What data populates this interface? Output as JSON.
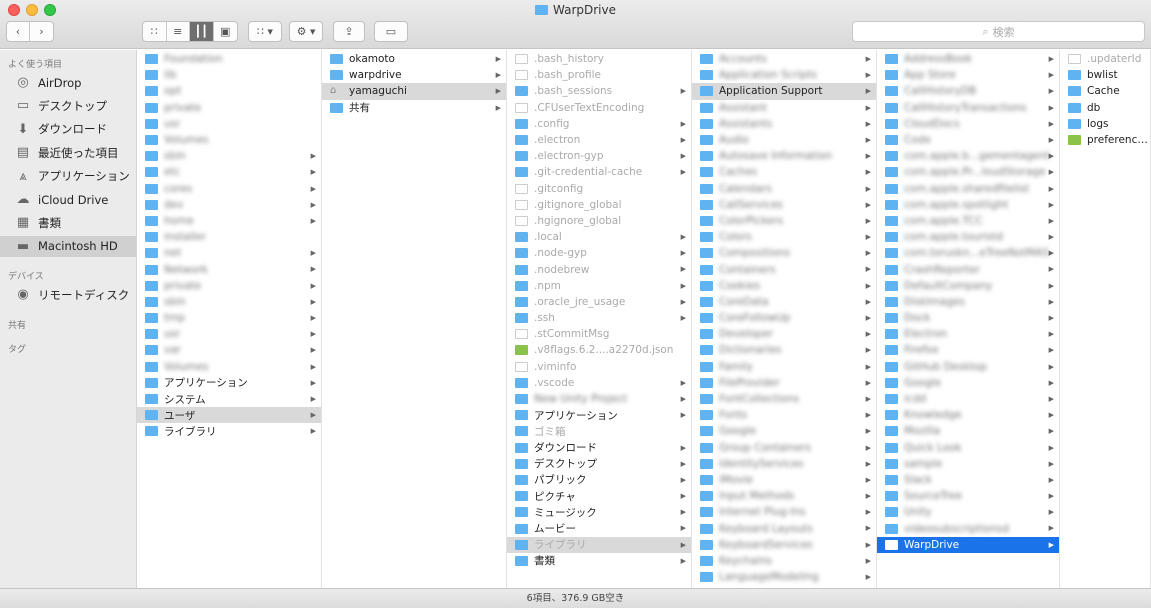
{
  "window": {
    "title": "WarpDrive"
  },
  "toolbar": {
    "search_placeholder": "検索"
  },
  "sidebar": {
    "sections": [
      {
        "label": "よく使う項目"
      },
      {
        "label": "デバイス"
      },
      {
        "label": "共有"
      },
      {
        "label": "タグ"
      }
    ],
    "favorites": [
      {
        "label": "AirDrop",
        "icon": "airdrop-icon"
      },
      {
        "label": "デスクトップ",
        "icon": "desktop-icon"
      },
      {
        "label": "ダウンロード",
        "icon": "download-icon"
      },
      {
        "label": "最近使った項目",
        "icon": "recent-icon"
      },
      {
        "label": "アプリケーション",
        "icon": "applications-icon"
      },
      {
        "label": "iCloud Drive",
        "icon": "cloud-icon"
      },
      {
        "label": "書類",
        "icon": "documents-icon"
      },
      {
        "label": "Macintosh HD",
        "icon": "disk-icon",
        "selected": true
      }
    ],
    "devices": [
      {
        "label": "リモートディスク",
        "icon": "remote-disc-icon"
      }
    ]
  },
  "columns": [
    {
      "name": "col-root",
      "rows": [
        {
          "label": "Foundation",
          "blur": true
        },
        {
          "label": "lib",
          "blur": true
        },
        {
          "label": "opt",
          "blur": true
        },
        {
          "label": "private",
          "blur": true
        },
        {
          "label": "usr",
          "blur": true
        },
        {
          "label": "Volumes",
          "blur": true
        },
        {
          "label": "sbin",
          "blur": true,
          "arrow": true
        },
        {
          "label": "etc",
          "blur": true,
          "arrow": true
        },
        {
          "label": "cores",
          "blur": true,
          "arrow": true
        },
        {
          "label": "dev",
          "blur": true,
          "arrow": true
        },
        {
          "label": "home",
          "blur": true,
          "arrow": true
        },
        {
          "label": "installer",
          "blur": true
        },
        {
          "label": "net",
          "blur": true,
          "arrow": true
        },
        {
          "label": "Network",
          "blur": true,
          "arrow": true
        },
        {
          "label": "private",
          "blur": true,
          "arrow": true
        },
        {
          "label": "sbin",
          "blur": true,
          "arrow": true
        },
        {
          "label": "tmp",
          "blur": true,
          "arrow": true
        },
        {
          "label": "usr",
          "blur": true,
          "arrow": true
        },
        {
          "label": "var",
          "blur": true,
          "arrow": true
        },
        {
          "label": "Volumes",
          "blur": true,
          "arrow": true
        },
        {
          "label": "アプリケーション",
          "arrow": true
        },
        {
          "label": "システム",
          "arrow": true
        },
        {
          "label": "ユーザ",
          "arrow": true,
          "state": "gray"
        },
        {
          "label": "ライブラリ",
          "arrow": true
        }
      ]
    },
    {
      "name": "col-users",
      "rows": [
        {
          "label": "okamoto",
          "arrow": true
        },
        {
          "label": "warpdrive",
          "arrow": true
        },
        {
          "label": "yamaguchi",
          "arrow": true,
          "state": "gray",
          "icon": "home"
        },
        {
          "label": "共有",
          "arrow": true
        }
      ]
    },
    {
      "name": "col-home",
      "rows": [
        {
          "label": ".bash_history",
          "doc": true,
          "dim": true
        },
        {
          "label": ".bash_profile",
          "doc": true,
          "dim": true
        },
        {
          "label": ".bash_sessions",
          "dim": true,
          "arrow": true
        },
        {
          "label": ".CFUserTextEncoding",
          "doc": true,
          "dim": true
        },
        {
          "label": ".config",
          "dim": true,
          "arrow": true
        },
        {
          "label": ".electron",
          "dim": true,
          "arrow": true
        },
        {
          "label": ".electron-gyp",
          "dim": true,
          "arrow": true
        },
        {
          "label": ".git-credential-cache",
          "dim": true,
          "arrow": true
        },
        {
          "label": ".gitconfig",
          "doc": true,
          "dim": true
        },
        {
          "label": ".gitignore_global",
          "doc": true,
          "dim": true
        },
        {
          "label": ".hgignore_global",
          "doc": true,
          "dim": true
        },
        {
          "label": ".local",
          "dim": true,
          "arrow": true
        },
        {
          "label": ".node-gyp",
          "dim": true,
          "arrow": true
        },
        {
          "label": ".nodebrew",
          "dim": true,
          "arrow": true
        },
        {
          "label": ".npm",
          "dim": true,
          "arrow": true
        },
        {
          "label": ".oracle_jre_usage",
          "dim": true,
          "arrow": true
        },
        {
          "label": ".ssh",
          "dim": true,
          "arrow": true
        },
        {
          "label": ".stCommitMsg",
          "doc": true,
          "dim": true
        },
        {
          "label": ".v8flags.6.2....a2270d.json",
          "dim": true,
          "icon": "green"
        },
        {
          "label": ".viminfo",
          "doc": true,
          "dim": true
        },
        {
          "label": ".vscode",
          "dim": true,
          "arrow": true
        },
        {
          "label": "New Unity Project",
          "blur": true,
          "arrow": true
        },
        {
          "label": "アプリケーション",
          "arrow": true
        },
        {
          "label": "ゴミ箱",
          "dim": true
        },
        {
          "label": "ダウンロード",
          "arrow": true
        },
        {
          "label": "デスクトップ",
          "arrow": true
        },
        {
          "label": "パブリック",
          "arrow": true
        },
        {
          "label": "ピクチャ",
          "arrow": true
        },
        {
          "label": "ミュージック",
          "arrow": true
        },
        {
          "label": "ムービー",
          "arrow": true
        },
        {
          "label": "ライブラリ",
          "arrow": true,
          "state": "gray",
          "dim": true
        },
        {
          "label": "書類",
          "arrow": true
        }
      ]
    },
    {
      "name": "col-library",
      "rows": [
        {
          "label": "Accounts",
          "blur": true,
          "arrow": true
        },
        {
          "label": "Application Scripts",
          "blur": true,
          "arrow": true
        },
        {
          "label": "Application Support",
          "arrow": true,
          "state": "gray"
        },
        {
          "label": "Assistant",
          "blur": true,
          "arrow": true
        },
        {
          "label": "Assistants",
          "blur": true,
          "arrow": true
        },
        {
          "label": "Audio",
          "blur": true,
          "arrow": true
        },
        {
          "label": "Autosave Information",
          "blur": true,
          "arrow": true
        },
        {
          "label": "Caches",
          "blur": true,
          "arrow": true
        },
        {
          "label": "Calendars",
          "blur": true,
          "arrow": true
        },
        {
          "label": "CallServices",
          "blur": true,
          "arrow": true
        },
        {
          "label": "ColorPickers",
          "blur": true,
          "arrow": true
        },
        {
          "label": "Colors",
          "blur": true,
          "arrow": true
        },
        {
          "label": "Compositions",
          "blur": true,
          "arrow": true
        },
        {
          "label": "Containers",
          "blur": true,
          "arrow": true
        },
        {
          "label": "Cookies",
          "blur": true,
          "arrow": true
        },
        {
          "label": "CoreData",
          "blur": true,
          "arrow": true
        },
        {
          "label": "CoreFollowUp",
          "blur": true,
          "arrow": true
        },
        {
          "label": "Developer",
          "blur": true,
          "arrow": true
        },
        {
          "label": "Dictionaries",
          "blur": true,
          "arrow": true
        },
        {
          "label": "Family",
          "blur": true,
          "arrow": true
        },
        {
          "label": "FileProvider",
          "blur": true,
          "arrow": true
        },
        {
          "label": "FontCollections",
          "blur": true,
          "arrow": true
        },
        {
          "label": "Fonts",
          "blur": true,
          "arrow": true
        },
        {
          "label": "Google",
          "blur": true,
          "arrow": true
        },
        {
          "label": "Group Containers",
          "blur": true,
          "arrow": true
        },
        {
          "label": "IdentityServices",
          "blur": true,
          "arrow": true
        },
        {
          "label": "iMovie",
          "blur": true,
          "arrow": true
        },
        {
          "label": "Input Methods",
          "blur": true,
          "arrow": true
        },
        {
          "label": "Internet Plug-Ins",
          "blur": true,
          "arrow": true
        },
        {
          "label": "Keyboard Layouts",
          "blur": true,
          "arrow": true
        },
        {
          "label": "KeyboardServices",
          "blur": true,
          "arrow": true
        },
        {
          "label": "Keychains",
          "blur": true,
          "arrow": true
        },
        {
          "label": "LanguageModeling",
          "blur": true,
          "arrow": true
        }
      ]
    },
    {
      "name": "col-appsupport",
      "rows": [
        {
          "label": "AddressBook",
          "blur": true,
          "arrow": true
        },
        {
          "label": "App Store",
          "blur": true,
          "arrow": true
        },
        {
          "label": "CallHistoryDB",
          "blur": true,
          "arrow": true
        },
        {
          "label": "CallHistoryTransactions",
          "blur": true,
          "arrow": true
        },
        {
          "label": "CloudDocs",
          "blur": true,
          "arrow": true
        },
        {
          "label": "Code",
          "blur": true,
          "arrow": true
        },
        {
          "label": "com.apple.b...gementagent",
          "blur": true,
          "arrow": true
        },
        {
          "label": "com.apple.Pr...loudStorage",
          "blur": true,
          "arrow": true
        },
        {
          "label": "com.apple.sharedfilelist",
          "blur": true,
          "arrow": true
        },
        {
          "label": "com.apple.spotlight",
          "blur": true,
          "arrow": true
        },
        {
          "label": "com.apple.TCC",
          "blur": true,
          "arrow": true
        },
        {
          "label": "com.apple.touristd",
          "blur": true,
          "arrow": true
        },
        {
          "label": "com.toruskn...eTreeNotMAS",
          "blur": true,
          "arrow": true
        },
        {
          "label": "CrashReporter",
          "blur": true,
          "arrow": true
        },
        {
          "label": "DefaultCompany",
          "blur": true,
          "arrow": true
        },
        {
          "label": "DiskImages",
          "blur": true,
          "arrow": true
        },
        {
          "label": "Dock",
          "blur": true,
          "arrow": true
        },
        {
          "label": "Electron",
          "blur": true,
          "arrow": true
        },
        {
          "label": "Firefox",
          "blur": true,
          "arrow": true
        },
        {
          "label": "GitHub Desktop",
          "blur": true,
          "arrow": true
        },
        {
          "label": "Google",
          "blur": true,
          "arrow": true
        },
        {
          "label": "icdd",
          "blur": true,
          "arrow": true
        },
        {
          "label": "Knowledge",
          "blur": true,
          "arrow": true
        },
        {
          "label": "Mozilla",
          "blur": true,
          "arrow": true
        },
        {
          "label": "Quick Look",
          "blur": true,
          "arrow": true
        },
        {
          "label": "sample",
          "blur": true,
          "arrow": true
        },
        {
          "label": "Slack",
          "blur": true,
          "arrow": true
        },
        {
          "label": "SourceTree",
          "blur": true,
          "arrow": true
        },
        {
          "label": "Unity",
          "blur": true,
          "arrow": true
        },
        {
          "label": "videosubscriptionsd",
          "blur": true,
          "arrow": true
        },
        {
          "label": "WarpDrive",
          "arrow": true,
          "state": "blue"
        }
      ]
    },
    {
      "name": "col-warpdrive",
      "rows": [
        {
          "label": ".updaterId",
          "doc": true,
          "dim": true
        },
        {
          "label": "bwlist"
        },
        {
          "label": "Cache"
        },
        {
          "label": "db"
        },
        {
          "label": "logs"
        },
        {
          "label": "preference.json",
          "icon": "green"
        }
      ]
    }
  ],
  "status": {
    "text": "6項目、376.9 GB空き"
  }
}
